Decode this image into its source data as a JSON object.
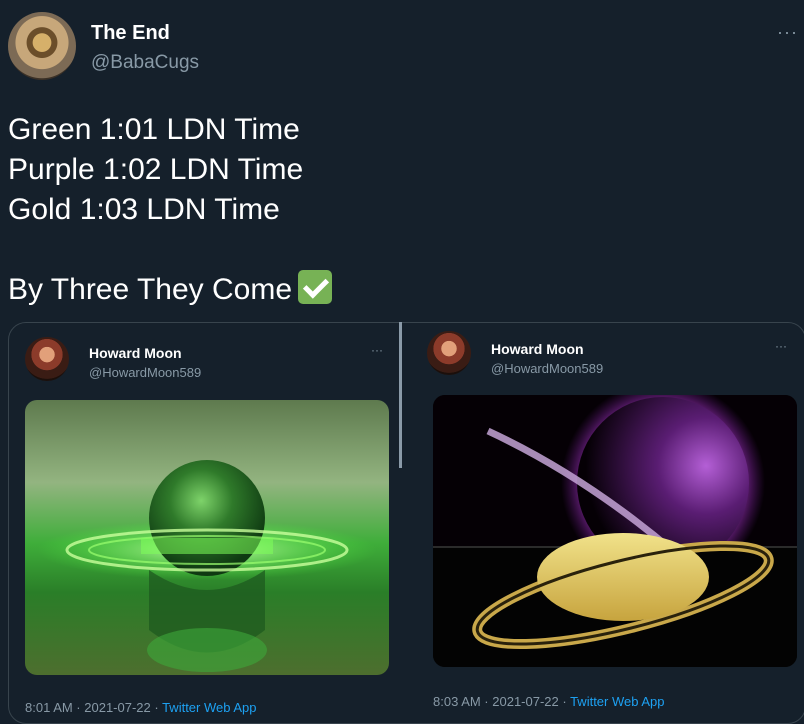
{
  "tweet": {
    "author_name": "The End",
    "author_handle": "@BabaCugs",
    "more_label": "···",
    "lines": [
      "Green 1:01 LDN Time",
      "Purple 1:02 LDN Time",
      "Gold 1:03 LDN Time"
    ],
    "closing_line": "By Three They Come"
  },
  "embedded": [
    {
      "author_name": "Howard Moon",
      "author_handle": "@HowardMoon589",
      "more_label": "···",
      "time": "8:01 AM · 2021-07-22 · ",
      "app": "Twitter Web App"
    },
    {
      "author_name": "Howard Moon",
      "author_handle": "@HowardMoon589",
      "more_label": "···",
      "time": "8:03 AM · 2021-07-22 · ",
      "app": "Twitter Web App"
    }
  ],
  "icons": {
    "check": "white-check-mark-icon"
  },
  "colors": {
    "background": "#15202b",
    "secondary_text": "#8899a6",
    "link": "#1da1f2",
    "check": "#77b255"
  }
}
